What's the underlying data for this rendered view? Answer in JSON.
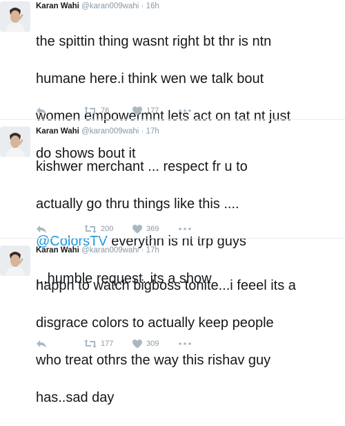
{
  "tweets": [
    {
      "name": "Karan Wahi",
      "handle": "@karan009wahi",
      "separator": "·",
      "time": "16h",
      "lines": [
        "the spittin thing wasnt right bt  thr is ntn",
        "humane here.i think wen we talk bout",
        "women empowermnt lets act on tat nt just",
        "do shows bout it"
      ],
      "retweets": "76",
      "likes": "177"
    },
    {
      "name": "Karan Wahi",
      "handle": "@karan009wahi",
      "separator": "·",
      "time": "17h",
      "lines": [
        "kishwer merchant ... respect fr u to",
        "actually go thru things like this ....",
        "everythn is nt trp guys",
        "...humble request..its a show"
      ],
      "mention": "@ColorsTV",
      "retweets": "200",
      "likes": "369"
    },
    {
      "name": "Karan Wahi",
      "handle": "@karan009wahi",
      "separator": "·",
      "time": "17h",
      "lines": [
        "happn to watch bigboss tonite...i feeel its a",
        "disgrace colors to actually keep people",
        "who treat othrs the way this rishav guy",
        "has..sad day"
      ],
      "retweets": "177",
      "likes": "309"
    }
  ],
  "icons": {
    "reply": "reply-icon",
    "retweet": "retweet-icon",
    "like": "heart-icon",
    "more": "more-icon"
  },
  "colors": {
    "link": "#1b95e0",
    "muted": "#8899a6",
    "icon": "#aab8c2",
    "divider": "#e6ecf0"
  }
}
